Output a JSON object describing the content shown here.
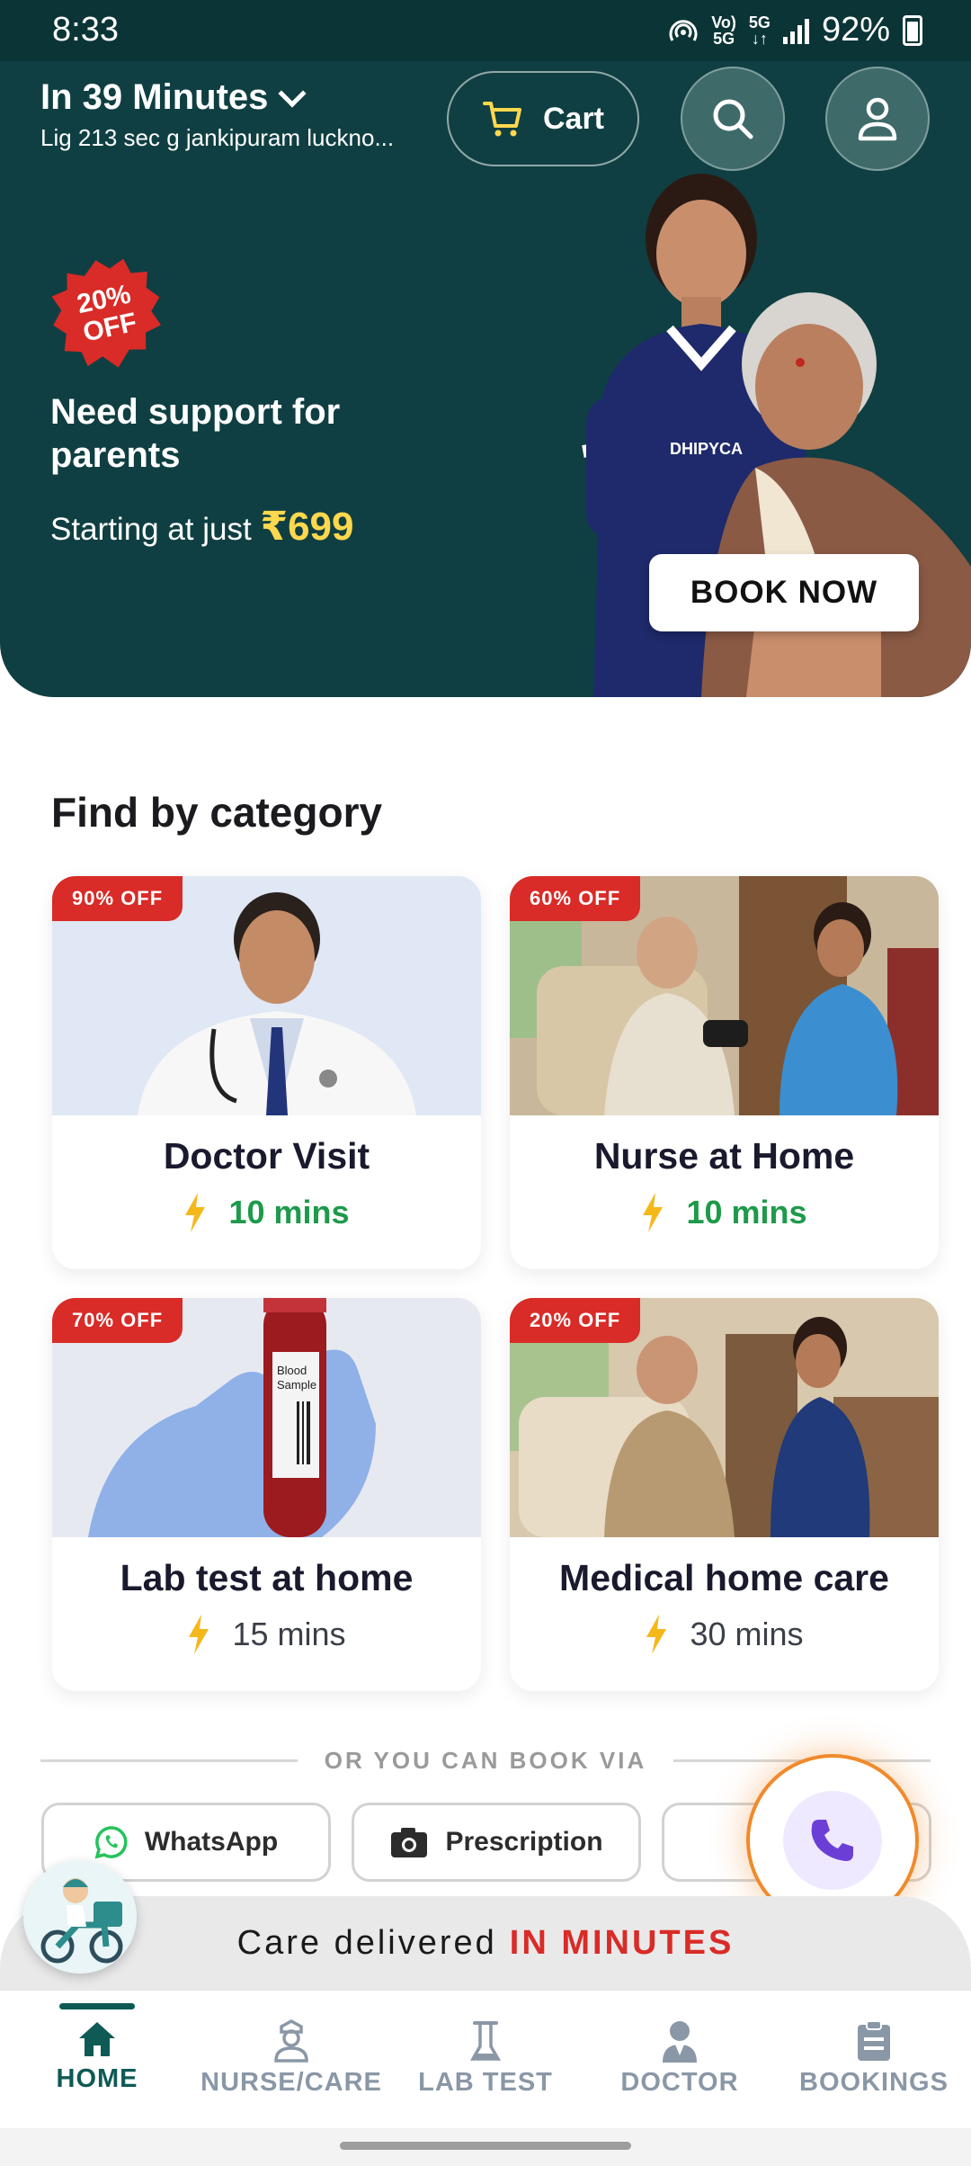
{
  "status_bar": {
    "time": "8:33",
    "network_top": "Vo)",
    "network_bottom": "5G",
    "data_top": "5G",
    "data_bottom": "↓↑",
    "battery": "92%"
  },
  "header": {
    "eta": "In 39 Minutes",
    "address": "Lig 213 sec g jankipuram luckno...",
    "cart_label": "Cart"
  },
  "hero": {
    "discount_line1": "20%",
    "discount_line2": "OFF",
    "title": "Need support for parents",
    "price_prefix": "Starting at just",
    "price": "₹699",
    "cta": "BOOK NOW",
    "uniform_text": "DHIPYCA"
  },
  "categories": {
    "title": "Find by category",
    "items": [
      {
        "badge": "90% OFF",
        "name": "Doctor Visit",
        "time": "10 mins"
      },
      {
        "badge": "60% OFF",
        "name": "Nurse at Home",
        "time": "10 mins"
      },
      {
        "badge": "70% OFF",
        "name": "Lab test at home",
        "time": "15 mins"
      },
      {
        "badge": "20% OFF",
        "name": "Medical home care",
        "time": "30 mins"
      }
    ],
    "tube_label_line1": "Blood",
    "tube_label_line2": "Sample"
  },
  "book_via": {
    "label": "OR YOU CAN BOOK VIA",
    "whatsapp": "WhatsApp",
    "prescription": "Prescription"
  },
  "care_strip": {
    "prefix": "Care delivered",
    "highlight": "IN MINUTES"
  },
  "nav": {
    "home": "HOME",
    "nurse": "NURSE/CARE",
    "lab": "LAB TEST",
    "doctor": "DOCTOR",
    "bookings": "BOOKINGS"
  },
  "colors": {
    "brand_dark": "#0f3f42",
    "accent_red": "#d92b27",
    "accent_yellow": "#ffd84d",
    "eta_green": "#1d9a4a",
    "nav_active": "#0f5a55"
  }
}
